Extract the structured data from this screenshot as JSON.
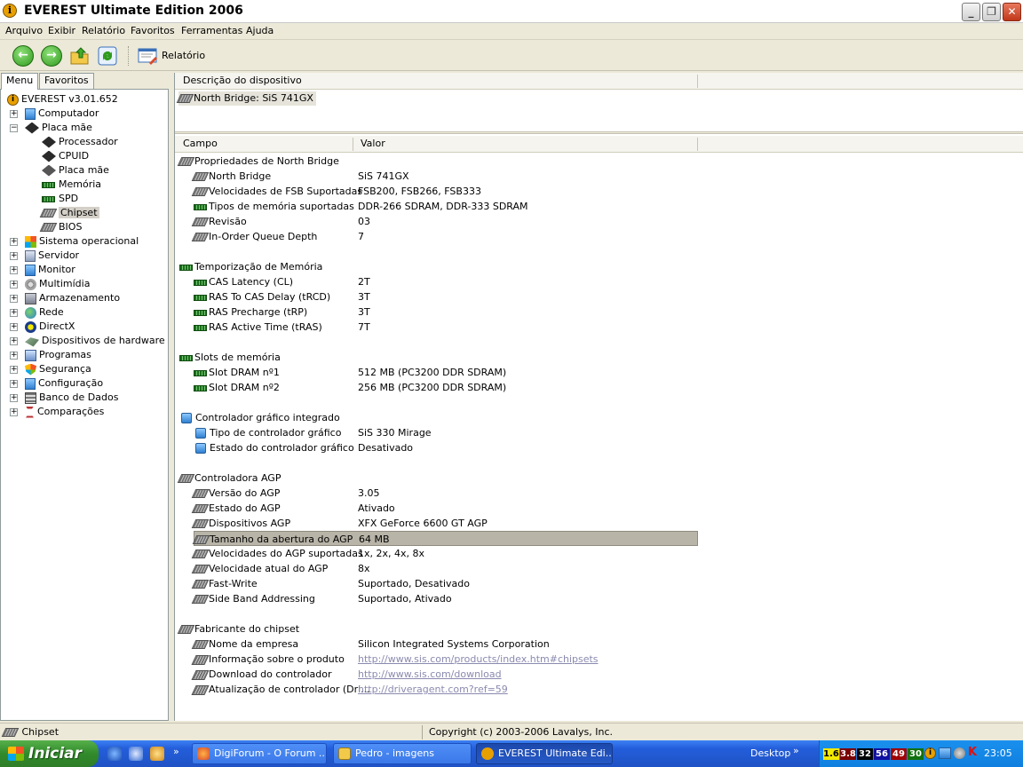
{
  "window": {
    "title": "EVEREST Ultimate Edition 2006",
    "buttons": {
      "minimize": "_",
      "maximize": "❐",
      "close": "✕"
    }
  },
  "menubar": [
    "Arquivo",
    "Exibir",
    "Relatório",
    "Favoritos",
    "Ferramentas",
    "Ajuda"
  ],
  "toolbar": {
    "report_label": "Relatório"
  },
  "left_tabs": [
    "Menu",
    "Favoritos"
  ],
  "tree": {
    "root": "EVEREST v3.01.652",
    "items": [
      {
        "label": "Computador",
        "icon": "computer-icon"
      },
      {
        "label": "Placa mãe",
        "icon": "motherboard-icon"
      },
      {
        "label": "Processador",
        "icon": "cpu-icon"
      },
      {
        "label": "CPUID",
        "icon": "cpu-icon"
      },
      {
        "label": "Placa mãe",
        "icon": "motherboard-icon"
      },
      {
        "label": "Memória",
        "icon": "memory-icon"
      },
      {
        "label": "SPD",
        "icon": "memory-icon"
      },
      {
        "label": "Chipset",
        "icon": "chip-icon"
      },
      {
        "label": "BIOS",
        "icon": "chip-icon"
      },
      {
        "label": "Sistema operacional",
        "icon": "windows-icon"
      },
      {
        "label": "Servidor",
        "icon": "server-icon"
      },
      {
        "label": "Monitor",
        "icon": "monitor-icon"
      },
      {
        "label": "Multimídia",
        "icon": "multimedia-icon"
      },
      {
        "label": "Armazenamento",
        "icon": "storage-icon"
      },
      {
        "label": "Rede",
        "icon": "network-icon"
      },
      {
        "label": "DirectX",
        "icon": "directx-icon"
      },
      {
        "label": "Dispositivos de hardware",
        "icon": "hardware-icon"
      },
      {
        "label": "Programas",
        "icon": "programs-icon"
      },
      {
        "label": "Segurança",
        "icon": "security-icon"
      },
      {
        "label": "Configuração",
        "icon": "config-icon"
      },
      {
        "label": "Banco de Dados",
        "icon": "database-icon"
      },
      {
        "label": "Comparações",
        "icon": "benchmark-icon"
      }
    ]
  },
  "device_panel": {
    "header": "Descrição do dispositivo",
    "device": "North Bridge: SiS 741GX"
  },
  "properties": {
    "col_field": "Campo",
    "col_value": "Valor",
    "sections": [
      {
        "title": "Propriedades de North Bridge",
        "icon": "chip",
        "rows": [
          {
            "field": "North Bridge",
            "value": "SiS 741GX",
            "icon": "chip"
          },
          {
            "field": "Velocidades de FSB Suportadas",
            "value": "FSB200, FSB266, FSB333",
            "icon": "chip"
          },
          {
            "field": "Tipos de memória suportadas",
            "value": "DDR-266 SDRAM, DDR-333 SDRAM",
            "icon": "mem"
          },
          {
            "field": "Revisão",
            "value": "03",
            "icon": "chip"
          },
          {
            "field": "In-Order Queue Depth",
            "value": "7",
            "icon": "chip"
          }
        ]
      },
      {
        "title": "Temporização de Memória",
        "icon": "mem",
        "rows": [
          {
            "field": "CAS Latency (CL)",
            "value": "2T",
            "icon": "mem"
          },
          {
            "field": "RAS To CAS Delay (tRCD)",
            "value": "3T",
            "icon": "mem"
          },
          {
            "field": "RAS Precharge (tRP)",
            "value": "3T",
            "icon": "mem"
          },
          {
            "field": "RAS Active Time (tRAS)",
            "value": "7T",
            "icon": "mem"
          }
        ]
      },
      {
        "title": "Slots de memória",
        "icon": "mem",
        "rows": [
          {
            "field": "Slot DRAM nº1",
            "value": "512 MB  (PC3200 DDR SDRAM)",
            "icon": "mem"
          },
          {
            "field": "Slot DRAM nº2",
            "value": "256 MB  (PC3200 DDR SDRAM)",
            "icon": "mem"
          }
        ]
      },
      {
        "title": "Controlador gráfico integrado",
        "icon": "mon",
        "rows": [
          {
            "field": "Tipo de controlador gráfico",
            "value": "SiS 330 Mirage",
            "icon": "mon"
          },
          {
            "field": "Estado do controlador gráfico",
            "value": "Desativado",
            "icon": "mon"
          }
        ]
      },
      {
        "title": "Controladora AGP",
        "icon": "chip",
        "rows": [
          {
            "field": "Versão do AGP",
            "value": "3.05",
            "icon": "chip"
          },
          {
            "field": "Estado do AGP",
            "value": "Ativado",
            "icon": "chip"
          },
          {
            "field": "Dispositivos AGP",
            "value": "XFX GeForce 6600 GT AGP",
            "icon": "chip"
          },
          {
            "field": "Tamanho da abertura do AGP",
            "value": "64 MB",
            "icon": "chip",
            "selected": true
          },
          {
            "field": "Velocidades do AGP suportadas",
            "value": "1x, 2x, 4x, 8x",
            "icon": "chip"
          },
          {
            "field": "Velocidade atual do AGP",
            "value": "8x",
            "icon": "chip"
          },
          {
            "field": "Fast-Write",
            "value": "Suportado, Desativado",
            "icon": "chip"
          },
          {
            "field": "Side Band Addressing",
            "value": "Suportado, Ativado",
            "icon": "chip"
          }
        ]
      },
      {
        "title": "Fabricante do chipset",
        "icon": "chip",
        "rows": [
          {
            "field": "Nome da empresa",
            "value": "Silicon Integrated Systems Corporation",
            "icon": "chip"
          },
          {
            "field": "Informação sobre o produto",
            "value": "http://www.sis.com/products/index.htm#chipsets",
            "icon": "chip",
            "link": true
          },
          {
            "field": "Download do controlador",
            "value": "http://www.sis.com/download",
            "icon": "chip",
            "link": true
          },
          {
            "field": "Atualização de controlador (Dri...",
            "value": "http://driveragent.com?ref=59",
            "icon": "chip",
            "link": true
          }
        ]
      }
    ]
  },
  "statusbar": {
    "left": "Chipset",
    "right": "Copyright (c) 2003-2006 Lavalys, Inc."
  },
  "taskbar": {
    "start": "Iniciar",
    "tasks": [
      {
        "label": "DigiForum - O Forum ...",
        "active": false
      },
      {
        "label": "Pedro - imagens",
        "active": false
      },
      {
        "label": "EVEREST Ultimate Edi...",
        "active": true
      }
    ],
    "desktop": "Desktop",
    "tray_values": [
      {
        "text": "1.6",
        "bg": "#f2e800",
        "fg": "#000"
      },
      {
        "text": "3.8",
        "bg": "#7a0000",
        "fg": "#fff"
      },
      {
        "text": "32",
        "bg": "#000000",
        "fg": "#fff"
      },
      {
        "text": "56",
        "bg": "#1010a0",
        "fg": "#fff"
      },
      {
        "text": "49",
        "bg": "#a00000",
        "fg": "#fff"
      },
      {
        "text": "30",
        "bg": "#107010",
        "fg": "#fff"
      }
    ],
    "clock": "23:05"
  }
}
